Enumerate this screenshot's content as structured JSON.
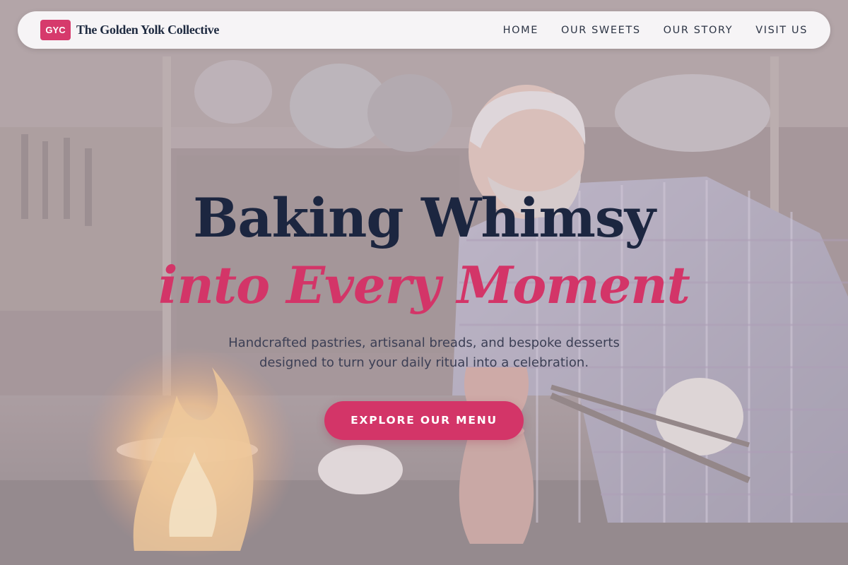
{
  "brand": {
    "badge": "GYC",
    "name": "The Golden Yolk Collective",
    "accent_color": "#d33568"
  },
  "nav": {
    "items": [
      {
        "label": "HOME"
      },
      {
        "label": "OUR SWEETS"
      },
      {
        "label": "OUR STORY"
      },
      {
        "label": "VISIT US"
      }
    ]
  },
  "hero": {
    "headline_line1": "Baking Whimsy",
    "headline_line2": "into Every Moment",
    "subtitle_line1": "Handcrafted pastries, artisanal breads, and bespoke desserts",
    "subtitle_line2": "designed to turn your daily ritual into a celebration.",
    "cta_label": "EXPLORE OUR MENU"
  }
}
